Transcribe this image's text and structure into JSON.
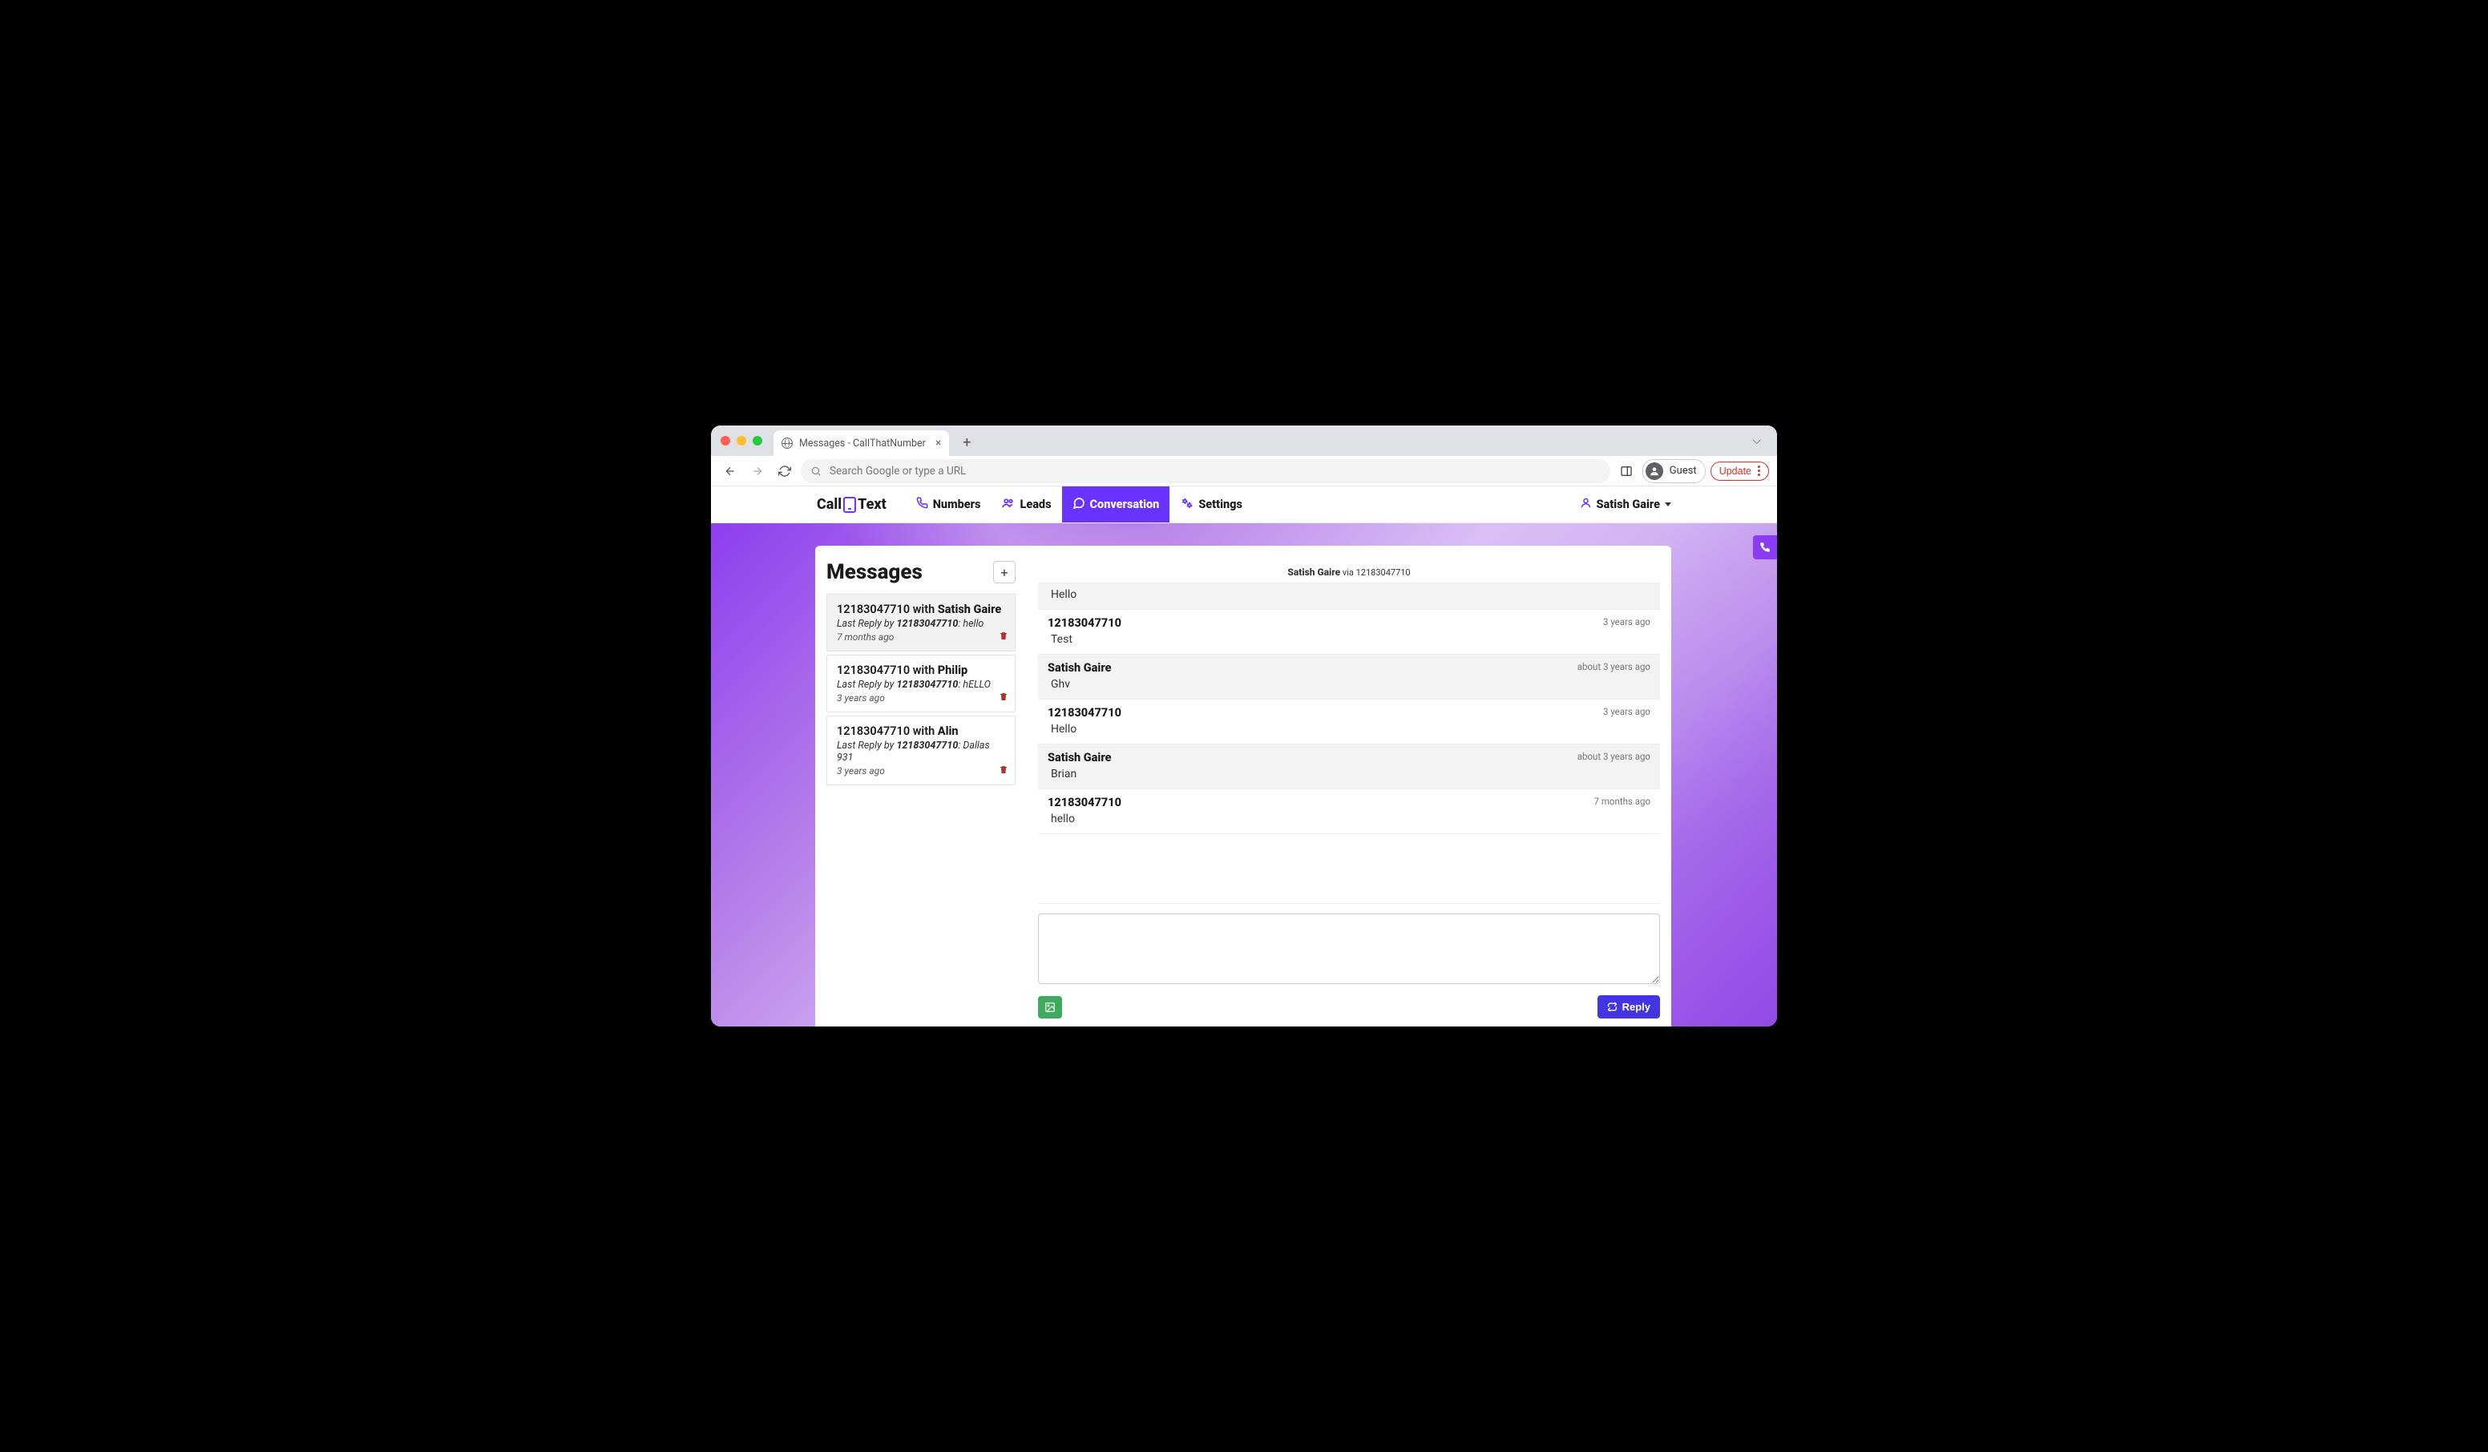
{
  "browser": {
    "tab_title": "Messages - CallThatNumber",
    "omnibox_placeholder": "Search Google or type a URL",
    "guest_label": "Guest",
    "update_label": "Update"
  },
  "app": {
    "logo_left": "Call",
    "logo_right": "Text",
    "nav": {
      "numbers": "Numbers",
      "leads": "Leads",
      "conversation": "Conversation",
      "settings": "Settings"
    },
    "user_name": "Satish Gaire"
  },
  "sidebar": {
    "title": "Messages",
    "items": [
      {
        "number": "12183047710",
        "with_label": "with",
        "contact": "Satish Gaire",
        "last_reply_prefix": "Last Reply by",
        "last_reply_number": "12183047710",
        "last_reply_text": ": hello",
        "time": "7 months ago",
        "selected": true
      },
      {
        "number": "12183047710",
        "with_label": "with",
        "contact": "Philip",
        "last_reply_prefix": "Last Reply by",
        "last_reply_number": "12183047710",
        "last_reply_text": ": hELLO",
        "time": "3 years ago",
        "selected": false
      },
      {
        "number": "12183047710",
        "with_label": "with",
        "contact": "Alin",
        "last_reply_prefix": "Last Reply by",
        "last_reply_number": "12183047710",
        "last_reply_text": ": Dallas 931",
        "time": "3 years ago",
        "selected": false
      }
    ]
  },
  "conversation": {
    "header_name": "Satish Gaire",
    "header_via": "via 12183047710",
    "messages": [
      {
        "sender": "",
        "body": "Hello",
        "time": "",
        "alt": true,
        "truncated": true
      },
      {
        "sender": "12183047710",
        "body": "Test",
        "time": "3 years ago",
        "alt": false
      },
      {
        "sender": "Satish Gaire",
        "body": "Ghv",
        "time": "about 3 years ago",
        "alt": true
      },
      {
        "sender": "12183047710",
        "body": "Hello",
        "time": "3 years ago",
        "alt": false
      },
      {
        "sender": "Satish Gaire",
        "body": "Brian",
        "time": "about 3 years ago",
        "alt": true
      },
      {
        "sender": "12183047710",
        "body": "hello",
        "time": "7 months ago",
        "alt": false
      }
    ],
    "reply_label": "Reply"
  }
}
